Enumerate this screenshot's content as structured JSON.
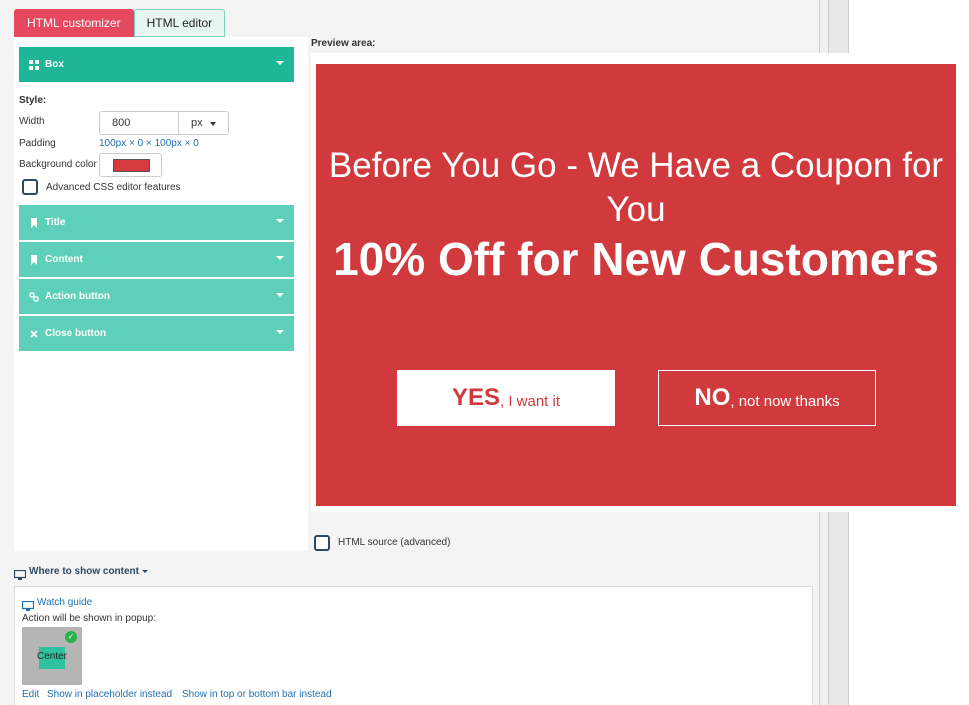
{
  "tabs": [
    {
      "label": "HTML customizer",
      "active": true
    },
    {
      "label": "HTML editor",
      "active": false
    }
  ],
  "sections": {
    "box": {
      "label": "Box",
      "icon": "grid-icon"
    },
    "title": {
      "label": "Title",
      "icon": "bookmark-icon"
    },
    "content": {
      "label": "Content",
      "icon": "bookmark-icon"
    },
    "action_button": {
      "label": "Action button",
      "icon": "link-icon"
    },
    "close_button": {
      "label": "Close button",
      "icon": "close-icon"
    }
  },
  "style": {
    "heading": "Style:",
    "width_label": "Width",
    "width_value": "800",
    "unit": "px",
    "padding_label": "Padding",
    "padding_value": "100px × 0 × 100px × 0",
    "bg_label": "Background color",
    "bg_color": "#d53b3e",
    "advanced_css": "Advanced CSS editor features"
  },
  "preview": {
    "label": "Preview area:",
    "title": "Before You Go - We Have a Coupon for You",
    "subtitle": "10% Off for New Customers",
    "yes_strong": "YES",
    "yes_rest": ", I want it",
    "no_strong": "NO",
    "no_rest": ", not now thanks",
    "bg_color": "#d13a3d"
  },
  "html_source": "HTML source (advanced)",
  "where": {
    "heading": "Where to show content",
    "watch_guide": "Watch guide",
    "action_text": "Action will be shown in popup:",
    "position": "Center",
    "links": [
      "Edit",
      "Show in placeholder instead",
      "Show in top or bottom bar instead"
    ]
  }
}
